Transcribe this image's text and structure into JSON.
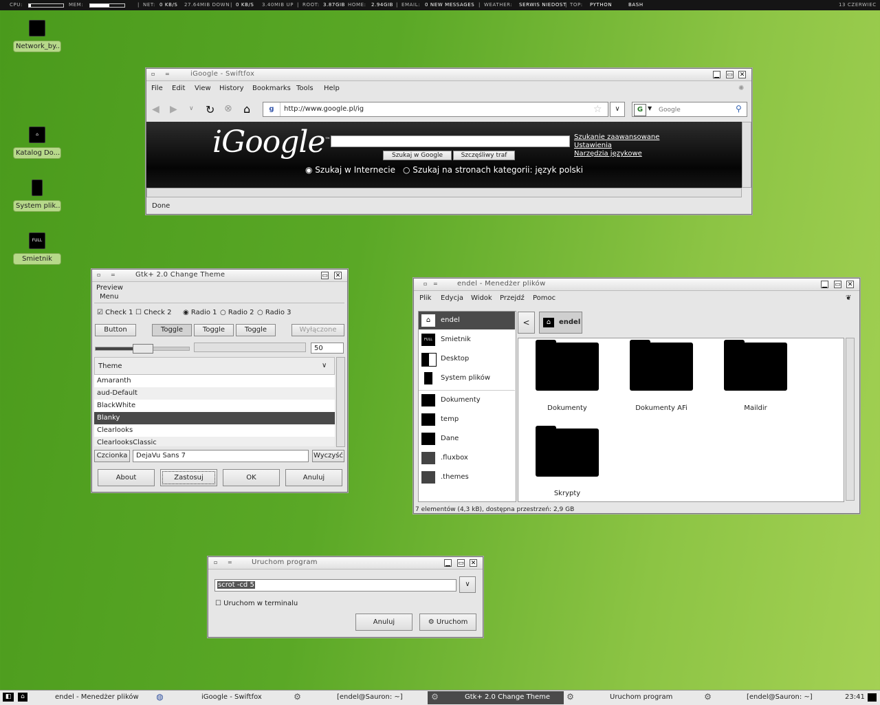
{
  "topbar": {
    "cpu_label": "cpu:",
    "mem_label": "mem:",
    "cpu_pct": 0.05,
    "mem_pct": 0.55,
    "net_label": "net:",
    "down_rate": "0 KB/s",
    "down_total": "27.64MiB down",
    "up_rate": "0 KB/s",
    "up_total": "3.40MiB up",
    "root_label": "root:",
    "root_val": "3.87GiB",
    "home_label": "home:",
    "home_val": "2.94GiB",
    "email_label": "email:",
    "email_val": "0 new messages",
    "weather_label": "weather:",
    "weather_val": "serwis niedost",
    "top_label": "top:",
    "top_1": "python",
    "top_2": "bash",
    "date": "13 czerwiec"
  },
  "desktop": {
    "icons": [
      {
        "label": "Network_by..."
      },
      {
        "label": "Katalog Do..."
      },
      {
        "label": "System plik..."
      },
      {
        "label": "Smietnik",
        "glyph": "FULL"
      }
    ]
  },
  "browser": {
    "title": "iGoogle - Swiftfox",
    "menu": [
      "File",
      "Edit",
      "View",
      "History",
      "Bookmarks",
      "Tools",
      "Help"
    ],
    "url": "http://www.google.pl/ig",
    "url_badge": "g",
    "search_placeholder": "Google",
    "search_engine_glyph": "G",
    "logo": "iGoogle",
    "logo_tm": "™",
    "search_btn": "Szukaj w Google",
    "lucky_btn": "Szczęśliwy traf",
    "link_advanced": "Szukanie zaawansowane",
    "link_settings": "Ustawienia",
    "link_tools": "Narzędzia językowe",
    "radio_web": "Szukaj w Internecie",
    "radio_lang": "Szukaj na stronach kategorii: język polski",
    "status": "Done"
  },
  "theme": {
    "title": "Gtk+ 2.0 Change Theme",
    "preview_label": "Preview",
    "menu_label": "Menu",
    "check1": "Check 1",
    "check2": "Check 2",
    "radio1": "Radio 1",
    "radio2": "Radio 2",
    "radio3": "Radio 3",
    "button": "Button",
    "toggle": "Toggle",
    "disabled": "Wyłączone",
    "spin_value": "50",
    "column": "Theme",
    "themes": [
      "Amaranth",
      "aud-Default",
      "BlackWhite",
      "Blanky",
      "Clearlooks",
      "ClearlooksClassic"
    ],
    "selected": "Blanky",
    "font_btn": "Czcionka",
    "font_value": "DejaVu Sans 7",
    "clear_btn": "Wyczyść",
    "about": "About",
    "apply": "Zastosuj",
    "ok": "OK",
    "cancel": "Anuluj"
  },
  "files": {
    "title": "endel - Menedżer plików",
    "menu": [
      "Plik",
      "Edycja",
      "Widok",
      "Przejdź",
      "Pomoc"
    ],
    "places": [
      {
        "label": "endel",
        "glyph": "house"
      },
      {
        "label": "Smietnik",
        "glyph": "FULL"
      },
      {
        "label": "Desktop"
      },
      {
        "label": "System plików"
      }
    ],
    "bookmarks": [
      {
        "label": "Dokumenty"
      },
      {
        "label": "temp"
      },
      {
        "label": "Dane"
      },
      {
        "label": ".fluxbox"
      },
      {
        "label": ".themes"
      }
    ],
    "path_button": "endel",
    "back_glyph": "<",
    "folders": [
      "Dokumenty",
      "Dokumenty AFi",
      "Maildir",
      "Skrypty"
    ],
    "status": "7 elementów (4,3 kB), dostępna przestrzeń: 2,9 GB"
  },
  "run": {
    "title": "Uruchom program",
    "command": "scrot -cd 5",
    "terminal_label": "Uruchom w terminalu",
    "cancel": "Anuluj",
    "run": "Uruchom"
  },
  "taskbar": {
    "tasks": [
      "endel - Menedżer plików",
      "iGoogle - Swiftfox",
      "[endel@Sauron: ~]",
      "Gtk+ 2.0 Change Theme",
      "Uruchom program",
      "[endel@Sauron: ~]"
    ],
    "clock": "23:41"
  }
}
